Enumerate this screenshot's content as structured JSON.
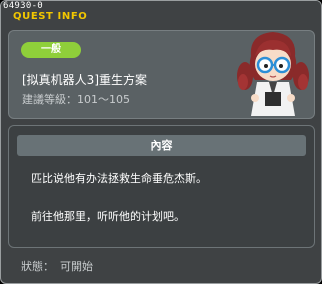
{
  "window": {
    "quest_id": "64930-0",
    "title": "QUEST INFO"
  },
  "quest": {
    "category_badge": "一般",
    "name": "[拟真机器人3]重生方案",
    "level_label": "建議等級：",
    "level_range": "101～105",
    "npc_icon": "npc-portrait-girl-with-glasses"
  },
  "content": {
    "header": "內容",
    "lines": [
      "匹比说他有办法拯救生命垂危杰斯。",
      "前往他那里，听听他的计划吧。"
    ]
  },
  "status": {
    "label": "狀態：",
    "value": "可開始"
  },
  "colors": {
    "title": "#f2c700",
    "badge": "#8fcf3a",
    "panel": "#5a6164",
    "background": "#3f4244"
  }
}
